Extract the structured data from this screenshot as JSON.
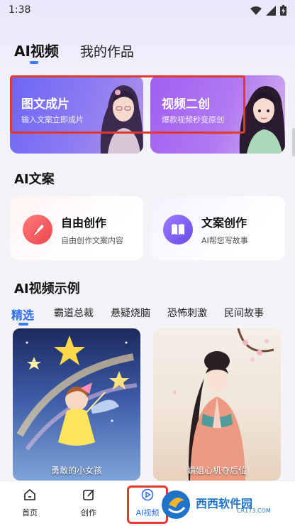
{
  "status": {
    "time": "1:38"
  },
  "top_tabs": [
    {
      "label": "AI视频",
      "active": true
    },
    {
      "label": "我的作品",
      "active": false
    }
  ],
  "banners": [
    {
      "title": "图文成片",
      "subtitle": "输入文案立即成片"
    },
    {
      "title": "视频二创",
      "subtitle": "爆款视频秒变原创"
    }
  ],
  "copy_section": {
    "title": "AI文案",
    "cards": [
      {
        "title": "自由创作",
        "subtitle": "自由创作文案内容",
        "icon": "feather-icon"
      },
      {
        "title": "文案创作",
        "subtitle": "AI帮您写故事",
        "icon": "book-icon"
      }
    ]
  },
  "examples_section": {
    "title": "AI视频示例",
    "categories": [
      "精选",
      "霸道总裁",
      "悬疑烧脑",
      "恐怖刺激",
      "民间故事"
    ],
    "active_category": "精选",
    "cards": [
      {
        "caption": "勇敢的小女孩"
      },
      {
        "caption": "嫡姐心机夺后位"
      }
    ]
  },
  "bottom_nav": [
    {
      "label": "首页",
      "icon": "home-icon"
    },
    {
      "label": "创作",
      "icon": "edit-icon"
    },
    {
      "label": "AI视频",
      "icon": "play-circle-icon",
      "active": true
    }
  ],
  "watermark": {
    "brand": "西西软件园",
    "domain": "CR173.COM"
  },
  "colors": {
    "accent": "#2a6df4",
    "highlight_frame": "#e03a2f"
  }
}
